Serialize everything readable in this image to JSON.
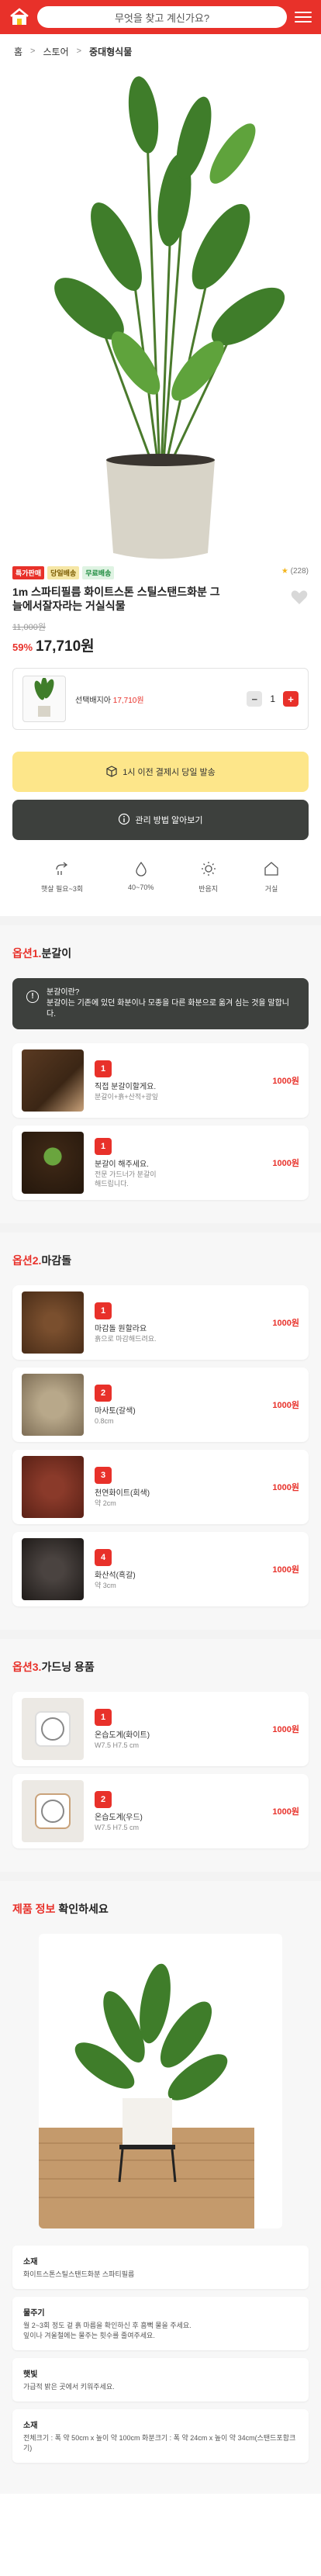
{
  "header": {
    "search_placeholder": "무엇을 찾고 계신가요?",
    "logo_icon": "house-logo-icon",
    "menu_icon": "hamburger-menu-icon",
    "brand_color": "#e8312a"
  },
  "breadcrumb": [
    "홈",
    "스토어",
    "중대형식물"
  ],
  "product": {
    "badges": [
      "특가판매",
      "당일배송",
      "무료배송"
    ],
    "rating_count": "(228)",
    "title": "1m 스파티필름 화이트스톤 스틸스탠드화분 그늘에서잘자라는 거실식물",
    "original_price": "11,000원",
    "discount": "59%",
    "price": "17,710원"
  },
  "selected": {
    "name_prefix": "선택배지아",
    "name_price": "17,710원",
    "qty": "1"
  },
  "buttons": {
    "delivery": "1시 이전 결제시 당일 발송",
    "care_guide": "관리 방법 알아보기"
  },
  "care": [
    {
      "icon": "sun-plant-icon",
      "label": "햇살 필요~3회"
    },
    {
      "icon": "droplet-icon",
      "label": "40~70%"
    },
    {
      "icon": "sun-icon",
      "label": "반음지"
    },
    {
      "icon": "house-icon",
      "label": "거실"
    }
  ],
  "section1": {
    "title_red": "옵션1.",
    "title": "분갈이",
    "notice": "분갈이란?\n분갈이는 기존에 있던 화분이나 모종을 다른 화분으로 옮겨 심는 것을 말합니다.",
    "options": [
      {
        "num": "1",
        "name": "직접 분갈이할게요.",
        "desc": "분갈이+흙+산적+광잎",
        "price": "1000원"
      },
      {
        "num": "1",
        "name": "분갈이 해주세요.",
        "desc": "전문 가드너가 분갈이\n해드립니다.",
        "price": "1000원"
      }
    ]
  },
  "section2": {
    "title_red": "옵션2.",
    "title": "마감돌",
    "options": [
      {
        "num": "1",
        "name": "마감돌 원할라요",
        "desc": "흙으로 마감해드려요.",
        "price": "1000원"
      },
      {
        "num": "2",
        "name": "마사토(갈색)",
        "desc": "0.8cm",
        "price": "1000원"
      },
      {
        "num": "3",
        "name": "천연화이트(회색)",
        "desc": "약 2cm",
        "price": "1000원"
      },
      {
        "num": "4",
        "name": "화산석(흑갈)",
        "desc": "약 3cm",
        "price": "1000원"
      }
    ]
  },
  "section3": {
    "title_red": "옵션3.",
    "title": "가드닝 용품",
    "options": [
      {
        "num": "1",
        "name": "온습도계(화이트)",
        "desc": "W7.5 H7.5 cm",
        "price": "1000원"
      },
      {
        "num": "2",
        "name": "온습도계(우드)",
        "desc": "W7.5 H7.5 cm",
        "price": "1000원"
      }
    ]
  },
  "info": {
    "title_red": "제품 정보",
    "title": "확인하세요",
    "cards": [
      {
        "label": "소재",
        "text": "화이트스톤스틸스탠드화분 스파티필름"
      },
      {
        "label": "물주기",
        "text": "월 2~3회 정도 겉 흙 마름을 확인하신 후 흠뻑 물을 주세요.\n잎이나 겨울철에는 물주는 횟수를 줄여주세요."
      },
      {
        "label": "햇빛",
        "text": "가급적 밝은 곳에서 키워주세요."
      },
      {
        "label": "소재",
        "text": "전체크기 : 폭 약 50cm x 높이 약 100cm 화분크기 : 폭 약 24cm x 높이 약 34cm(스탠드포함크기)"
      }
    ]
  }
}
